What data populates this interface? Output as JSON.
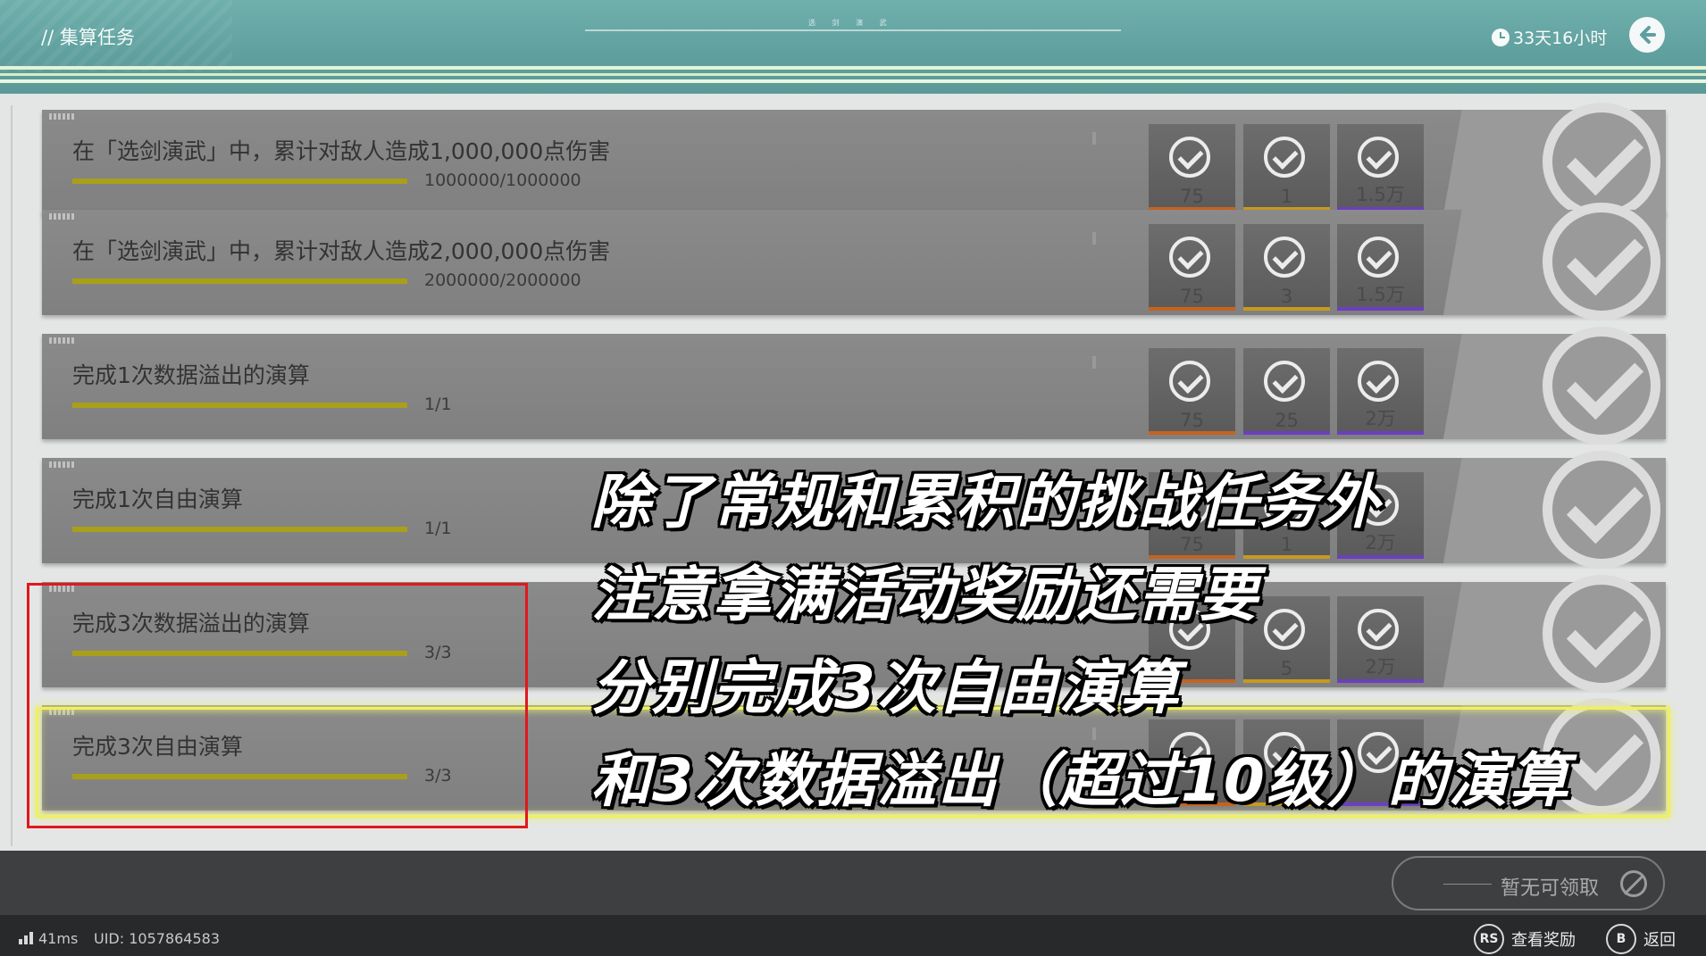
{
  "header": {
    "title": "// 集算任务",
    "center_text": "选 剑 演 武",
    "timer": "33天16小时"
  },
  "tasks": [
    {
      "title": "在「选剑演武」中，累计对敌人造成1,000,000点伤害",
      "progress_text": "1000000/1000000",
      "progress": 1.0,
      "rewards": [
        {
          "count": "75",
          "color": "#c7621e"
        },
        {
          "count": "1",
          "color": "#c79a1e"
        },
        {
          "count": "1.5万",
          "color": "#6b3fc0"
        }
      ]
    },
    {
      "title": "在「选剑演武」中，累计对敌人造成2,000,000点伤害",
      "progress_text": "2000000/2000000",
      "progress": 1.0,
      "rewards": [
        {
          "count": "75",
          "color": "#c7621e"
        },
        {
          "count": "3",
          "color": "#c79a1e"
        },
        {
          "count": "1.5万",
          "color": "#6b3fc0"
        }
      ]
    },
    {
      "title": "完成1次数据溢出的演算",
      "progress_text": "1/1",
      "progress": 1.0,
      "rewards": [
        {
          "count": "75",
          "color": "#c7621e"
        },
        {
          "count": "25",
          "color": "#6b3fc0"
        },
        {
          "count": "2万",
          "color": "#6b3fc0"
        }
      ]
    },
    {
      "title": "完成1次自由演算",
      "progress_text": "1/1",
      "progress": 1.0,
      "rewards": [
        {
          "count": "75",
          "color": "#c7621e"
        },
        {
          "count": "1",
          "color": "#c79a1e"
        },
        {
          "count": "2万",
          "color": "#6b3fc0"
        }
      ]
    },
    {
      "title": "完成3次数据溢出的演算",
      "progress_text": "3/3",
      "progress": 1.0,
      "rewards": [
        {
          "count": "",
          "color": "#c7621e"
        },
        {
          "count": "5",
          "color": "#c79a1e"
        },
        {
          "count": "2万",
          "color": "#6b3fc0"
        }
      ]
    },
    {
      "title": "完成3次自由演算",
      "progress_text": "3/3",
      "progress": 1.0,
      "rewards": [
        {
          "count": "",
          "color": "#c7621e"
        },
        {
          "count": "",
          "color": "#c79a1e"
        },
        {
          "count": "",
          "color": "#6b3fc0"
        }
      ]
    }
  ],
  "caption": [
    "除了常规和累积的挑战任务外",
    "注意拿满活动奖励还需要",
    "分别完成3次自由演算",
    "和3次数据溢出（超过10级）的演算"
  ],
  "footer": {
    "claim_label": "暂无可领取",
    "ping": "41ms",
    "uid": "UID: 1057864583",
    "hint_view_key": "RS",
    "hint_view_label": "查看奖励",
    "hint_back_key": "B",
    "hint_back_label": "返回"
  },
  "colors": {
    "header": "#5f9f9d",
    "progress": "#a8a019",
    "highlight": "#f0f060",
    "annotation_box": "#e0181e"
  }
}
